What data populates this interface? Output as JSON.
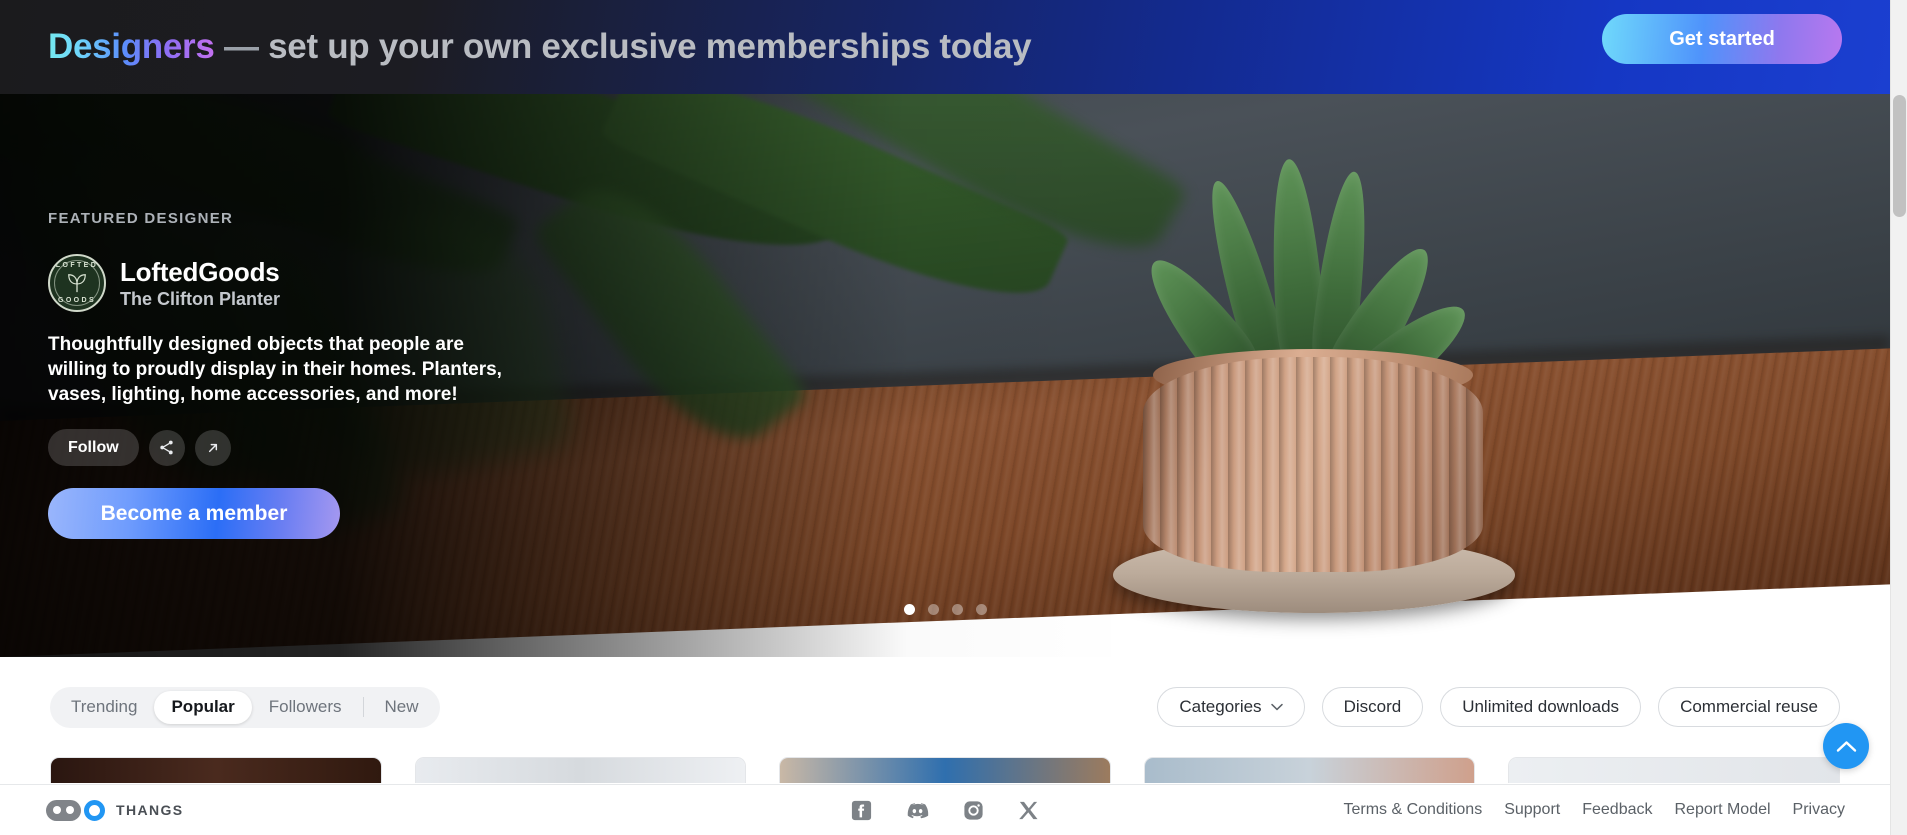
{
  "promo_banner": {
    "highlight_word": "Designers",
    "dash": " — ",
    "rest_text": "set up your own exclusive memberships today",
    "cta_label": "Get started",
    "gradient_start": "#74e8ef",
    "gradient_end": "#c470f0",
    "bg_left": "#1b1b1d",
    "bg_right": "#1b3fd0"
  },
  "hero": {
    "eyebrow": "FEATURED DESIGNER",
    "designer_name": "LoftedGoods",
    "product_name": "The Clifton Planter",
    "bio": "Thoughtfully designed objects that people are willing to proudly display in their homes. Planters, vases, lighting, home accessories, and more!",
    "follow_label": "Follow",
    "share_icon": "share-icon",
    "external_icon": "external-link-icon",
    "member_label": "Become a member",
    "avatar": {
      "top_word": "LOFTED",
      "bottom_word": "GOODS",
      "icon": "plant-leaf-icon",
      "bg_color": "#1e3320"
    },
    "carousel": {
      "total": 4,
      "active_index": 0
    }
  },
  "filter_bar": {
    "tabs": [
      {
        "label": "Trending",
        "active": false
      },
      {
        "label": "Popular",
        "active": true
      },
      {
        "label": "Followers",
        "active": false
      },
      {
        "label": "New",
        "active": false
      }
    ],
    "separator_before_index": 3,
    "chips": [
      {
        "label": "Categories",
        "icon": "chevron-down-icon"
      },
      {
        "label": "Discord",
        "icon": null
      },
      {
        "label": "Unlimited downloads",
        "icon": null
      },
      {
        "label": "Commercial reuse",
        "icon": null
      }
    ]
  },
  "card_strip": {
    "cards": [
      {
        "accent": "#3a2018"
      },
      {
        "accent": "#dfe3e8"
      },
      {
        "accent": "#2f6fae"
      },
      {
        "accent": "#9fb2c4"
      },
      {
        "accent": "#e9ecef"
      }
    ]
  },
  "scroll_top": {
    "icon": "chevron-up-icon",
    "color": "#2196f3"
  },
  "footer": {
    "brand_name": "THANGS",
    "brand_accent": "#2196f3",
    "social": [
      {
        "name": "facebook-icon"
      },
      {
        "name": "discord-icon"
      },
      {
        "name": "instagram-icon"
      },
      {
        "name": "x-twitter-icon"
      }
    ],
    "links": [
      "Terms & Conditions",
      "Support",
      "Feedback",
      "Report Model",
      "Privacy"
    ]
  }
}
